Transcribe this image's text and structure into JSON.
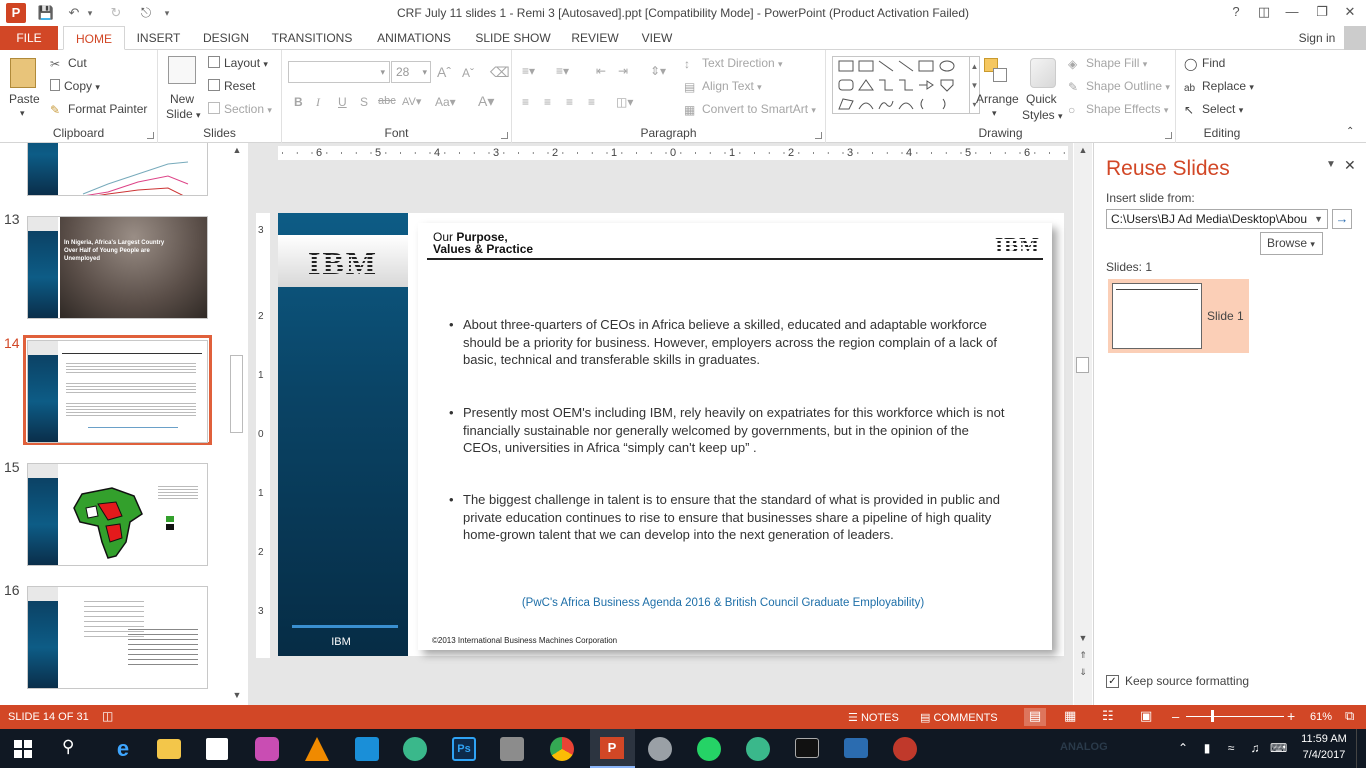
{
  "window": {
    "title": "CRF July 11 slides 1 - Remi 3 [Autosaved].ppt [Compatibility Mode] - PowerPoint (Product Activation Failed)",
    "help": "?",
    "sign_in": "Sign in"
  },
  "tabs": [
    "FILE",
    "HOME",
    "INSERT",
    "DESIGN",
    "TRANSITIONS",
    "ANIMATIONS",
    "SLIDE SHOW",
    "REVIEW",
    "VIEW"
  ],
  "ribbon": {
    "clipboard": {
      "paste": "Paste",
      "cut": "Cut",
      "copy": "Copy",
      "format_painter": "Format Painter",
      "label": "Clipboard"
    },
    "slides": {
      "new_slide_1": "New",
      "new_slide_2": "Slide",
      "layout": "Layout",
      "reset": "Reset",
      "section": "Section",
      "label": "Slides"
    },
    "font": {
      "font_size": "28",
      "label": "Font"
    },
    "paragraph": {
      "text_direction": "Text Direction",
      "align_text": "Align Text",
      "convert_smartart": "Convert to SmartArt",
      "label": "Paragraph"
    },
    "drawing": {
      "arrange": "Arrange",
      "quick_styles_1": "Quick",
      "quick_styles_2": "Styles",
      "shape_fill": "Shape Fill",
      "shape_outline": "Shape Outline",
      "shape_effects": "Shape Effects",
      "label": "Drawing"
    },
    "editing": {
      "find": "Find",
      "replace": "Replace",
      "select": "Select",
      "label": "Editing"
    }
  },
  "thumbnails": {
    "numbers": [
      "13",
      "14",
      "15",
      "16"
    ],
    "slide13_caption": "In Nigeria, Africa's Largest Country Over Half of Young People are Unemployed"
  },
  "ruler": {
    "h_ticks": [
      "6",
      "5",
      "4",
      "3",
      "2",
      "1",
      "0",
      "1",
      "2",
      "3",
      "4",
      "5",
      "6"
    ],
    "v_ticks": [
      "3",
      "2",
      "1",
      "0",
      "1",
      "2",
      "3"
    ]
  },
  "slide": {
    "header_plain": "Our ",
    "header_bold_1": "Purpose,",
    "header_bold_2": "Values & Practice",
    "logo": "IBM",
    "left_logo": "IBM",
    "left_footer": "IBM",
    "bullets": [
      "About three-quarters of CEOs in Africa believe a skilled, educated and adaptable workforce should be a priority for business. However, employers across the region complain of a lack of basic, technical and transferable skills in graduates.",
      "Presently most OEM's including IBM, rely heavily on expatriates for this workforce which is not financially sustainable nor generally welcomed by governments, but in the opinion of the CEOs, universities in Africa “simply can't keep up” .",
      "The biggest challenge in talent is to ensure that the standard of what is provided in public and private education continues to rise to ensure that businesses  share a pipeline of high quality home-grown talent that we can develop into the next generation of leaders."
    ],
    "source": "(PwC's Africa Business Agenda 2016 & British Council Graduate Employability)",
    "copyright": "©2013 International Business Machines Corporation"
  },
  "reuse_panel": {
    "title": "Reuse Slides",
    "insert_from_label": "Insert slide from:",
    "path_value": "C:\\Users\\BJ Ad Media\\Desktop\\Abou",
    "browse": "Browse",
    "slides_count": "Slides: 1",
    "slide_item": "Slide 1",
    "keep_source": "Keep source formatting"
  },
  "status": {
    "slide_info": "SLIDE 14 OF 31",
    "notes": "NOTES",
    "comments": "COMMENTS",
    "zoom": "61%"
  },
  "taskbar": {
    "time": "11:59 AM",
    "date": "7/4/2017",
    "ghost_label": "ANALOG"
  },
  "colors": {
    "accent": "#d24726",
    "slide_blue": "#0a4466",
    "source_blue": "#1e6fa8"
  }
}
